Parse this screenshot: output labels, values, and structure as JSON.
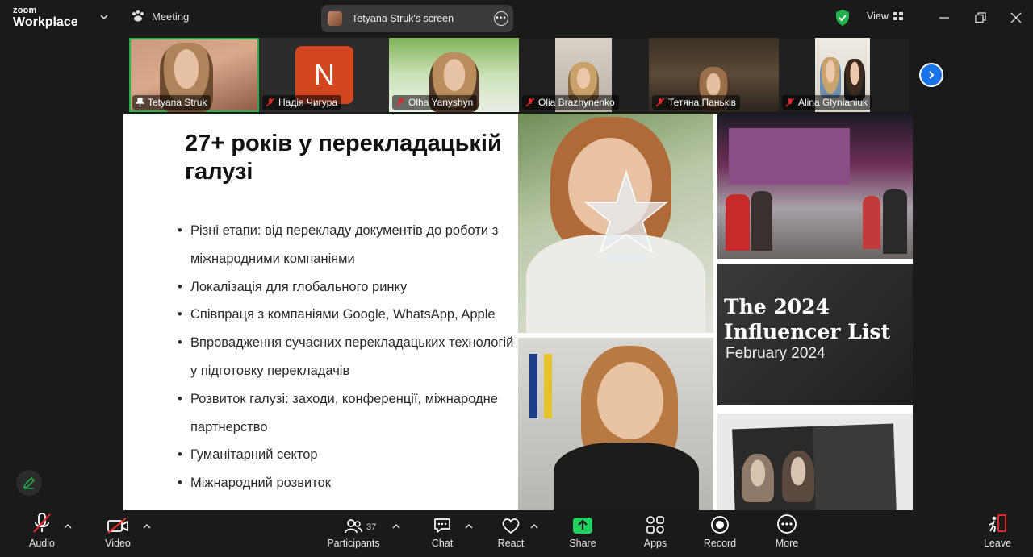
{
  "app": {
    "brand_line1": "zoom",
    "brand_line2": "Workplace"
  },
  "header": {
    "meeting_label": "Meeting",
    "share_title": "Tetyana Struk's screen",
    "view_label": "View"
  },
  "participants": [
    {
      "name": "Tetyana Struk",
      "pinned": true,
      "muted": false
    },
    {
      "name": "Надія Чигура",
      "muted": true,
      "initial": "N"
    },
    {
      "name": "Olha Yanyshyn",
      "muted": true
    },
    {
      "name": "Olia Brazhynenko",
      "muted": true
    },
    {
      "name": "Тетяна Паньків",
      "muted": true
    },
    {
      "name": "Alina Glynianiuk",
      "muted": true
    }
  ],
  "slide": {
    "title": "27+ років у перекладацькій галузі",
    "bullets": [
      "Різні етапи: від перекладу документів до роботи з міжнародними компаніями",
      "Локалізація для глобального ринку",
      "Співпраця з компаніями Google, WhatsApp, Apple",
      "Впровадження сучасних перекладацьких технологій у підготовку перекладачів",
      "Розвиток галузі: заходи, конференції, міжнародне партнерство",
      "Гуманітарний сектор",
      "Міжнародний розвиток"
    ],
    "influencer_title": "The 2024 Influencer List",
    "influencer_subtitle": "February 2024"
  },
  "toolbar": {
    "audio": "Audio",
    "video": "Video",
    "participants": "Participants",
    "participants_count": "37",
    "chat": "Chat",
    "react": "React",
    "share": "Share",
    "apps": "Apps",
    "record": "Record",
    "more": "More",
    "leave": "Leave"
  },
  "colors": {
    "accent_green": "#22b14c",
    "leave_red": "#e02828",
    "share_green": "#23d160",
    "nav_blue": "#1a73e8"
  }
}
